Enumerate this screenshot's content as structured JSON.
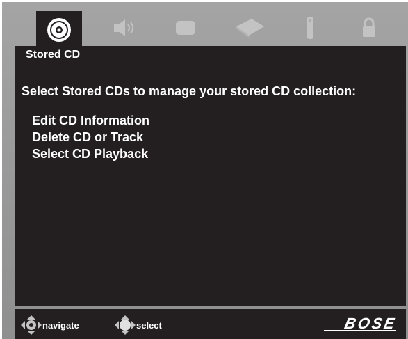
{
  "menu_bar": {
    "icons": [
      "cd-icon",
      "speaker-icon",
      "tv-icon",
      "disc-tray-icon",
      "remote-icon",
      "lock-icon"
    ]
  },
  "screen": {
    "title": "Stored CD",
    "intro": "Select Stored CDs to manage your stored CD collection:",
    "items": [
      {
        "label": "Edit CD Information"
      },
      {
        "label": "Delete CD or Track"
      },
      {
        "label": "Select CD Playback"
      }
    ]
  },
  "footer": {
    "navigate_label": "navigate",
    "select_label": "select",
    "brand": "BOSE"
  },
  "colors": {
    "panel": "#231f20",
    "frame": "#a4a4a4",
    "inactive_icon": "#c3c3c3"
  }
}
